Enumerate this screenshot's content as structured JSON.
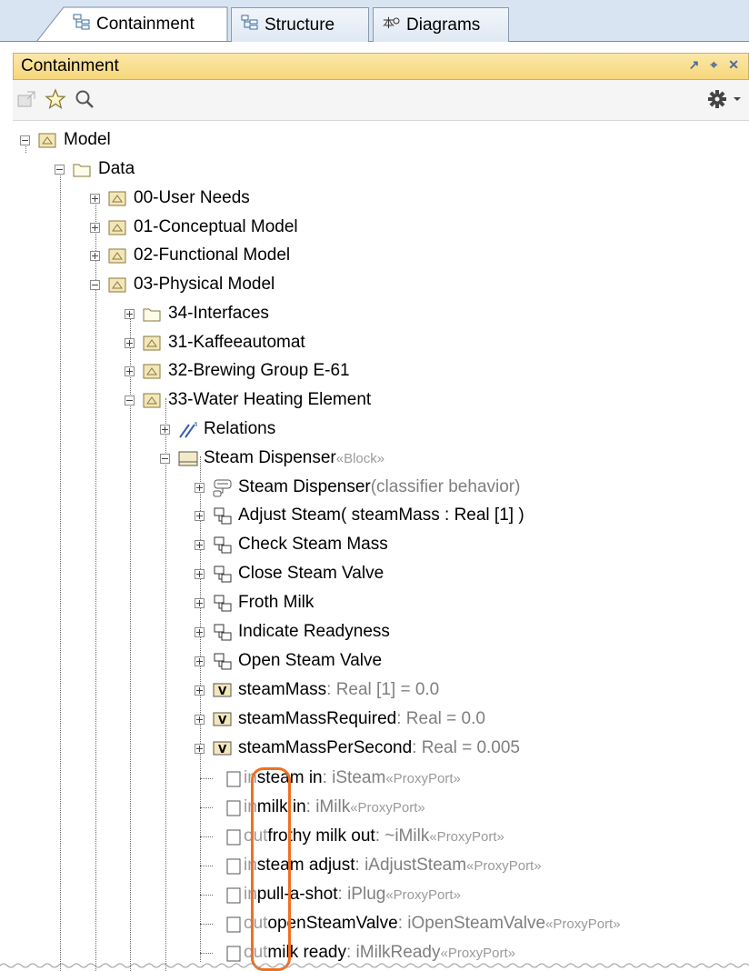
{
  "tabs": [
    {
      "label": "Containment",
      "icon": "containment-tree-icon",
      "active": true
    },
    {
      "label": "Structure",
      "icon": "structure-icon",
      "active": false
    },
    {
      "label": "Diagrams",
      "icon": "diagrams-icon",
      "active": false
    }
  ],
  "panel": {
    "title": "Containment",
    "controls": [
      "restore-icon",
      "pin-icon",
      "close-icon"
    ]
  },
  "toolbar": {
    "left": [
      "open-spec-icon",
      "favorite-star-icon",
      "search-icon"
    ],
    "right": [
      "settings-gear-icon",
      "dropdown-icon"
    ]
  },
  "tree": {
    "rows": [
      {
        "label": "Model",
        "extra": ""
      },
      {
        "label": "Data",
        "extra": ""
      },
      {
        "label": "00-User Needs",
        "extra": ""
      },
      {
        "label": "01-Conceptual Model",
        "extra": ""
      },
      {
        "label": "02-Functional Model",
        "extra": ""
      },
      {
        "label": "03-Physical Model",
        "extra": ""
      },
      {
        "label": "34-Interfaces",
        "extra": ""
      },
      {
        "label": "31-Kaffeeautomat",
        "extra": ""
      },
      {
        "label": "32-Brewing Group E-61",
        "extra": ""
      },
      {
        "label": "33-Water Heating Element",
        "extra": ""
      },
      {
        "label": "Relations",
        "extra": ""
      },
      {
        "label": "Steam Dispenser ",
        "extra": "«Block»"
      },
      {
        "label": "Steam Dispenser",
        "extra": "(classifier behavior)"
      },
      {
        "label": "Adjust Steam( steamMass : Real [1] )",
        "extra": ""
      },
      {
        "label": "Check Steam Mass",
        "extra": ""
      },
      {
        "label": "Close Steam Valve",
        "extra": ""
      },
      {
        "label": "Froth Milk",
        "extra": ""
      },
      {
        "label": "Indicate Readyness",
        "extra": ""
      },
      {
        "label": "Open Steam Valve",
        "extra": ""
      },
      {
        "label": "steamMass",
        "type": " : Real [1] = 0.0"
      },
      {
        "label": "steamMassRequired",
        "type": " : Real = 0.0"
      },
      {
        "label": "steamMassPerSecond",
        "type": " : Real = 0.005"
      },
      {
        "dir": "in ",
        "label": "steam in",
        "type": " : iSteam ",
        "stereo": "«ProxyPort»"
      },
      {
        "dir": "in ",
        "label": "milk in",
        "type": " : iMilk ",
        "stereo": "«ProxyPort»"
      },
      {
        "dir": "out ",
        "label": "frothy milk out",
        "type": " : ~iMilk ",
        "stereo": "«ProxyPort»"
      },
      {
        "dir": "in ",
        "label": "steam adjust",
        "type": " : iAdjustSteam ",
        "stereo": "«ProxyPort»"
      },
      {
        "dir": "in ",
        "label": "pull-a-shot",
        "type": " : iPlug ",
        "stereo": "«ProxyPort»"
      },
      {
        "dir": "out ",
        "label": "openSteamValve",
        "type": " : iOpenSteamValve ",
        "stereo": "«ProxyPort»"
      },
      {
        "dir": "out ",
        "label": "milk ready",
        "type": " : iMilkReady ",
        "stereo": "«ProxyPort»"
      }
    ]
  },
  "colors": {
    "tab_bg": "#d8e4f2",
    "panel_header": "#f6d77a",
    "highlight": "#f07020",
    "package_icon": "#d9c07a",
    "value_icon": "#e8d27a"
  }
}
